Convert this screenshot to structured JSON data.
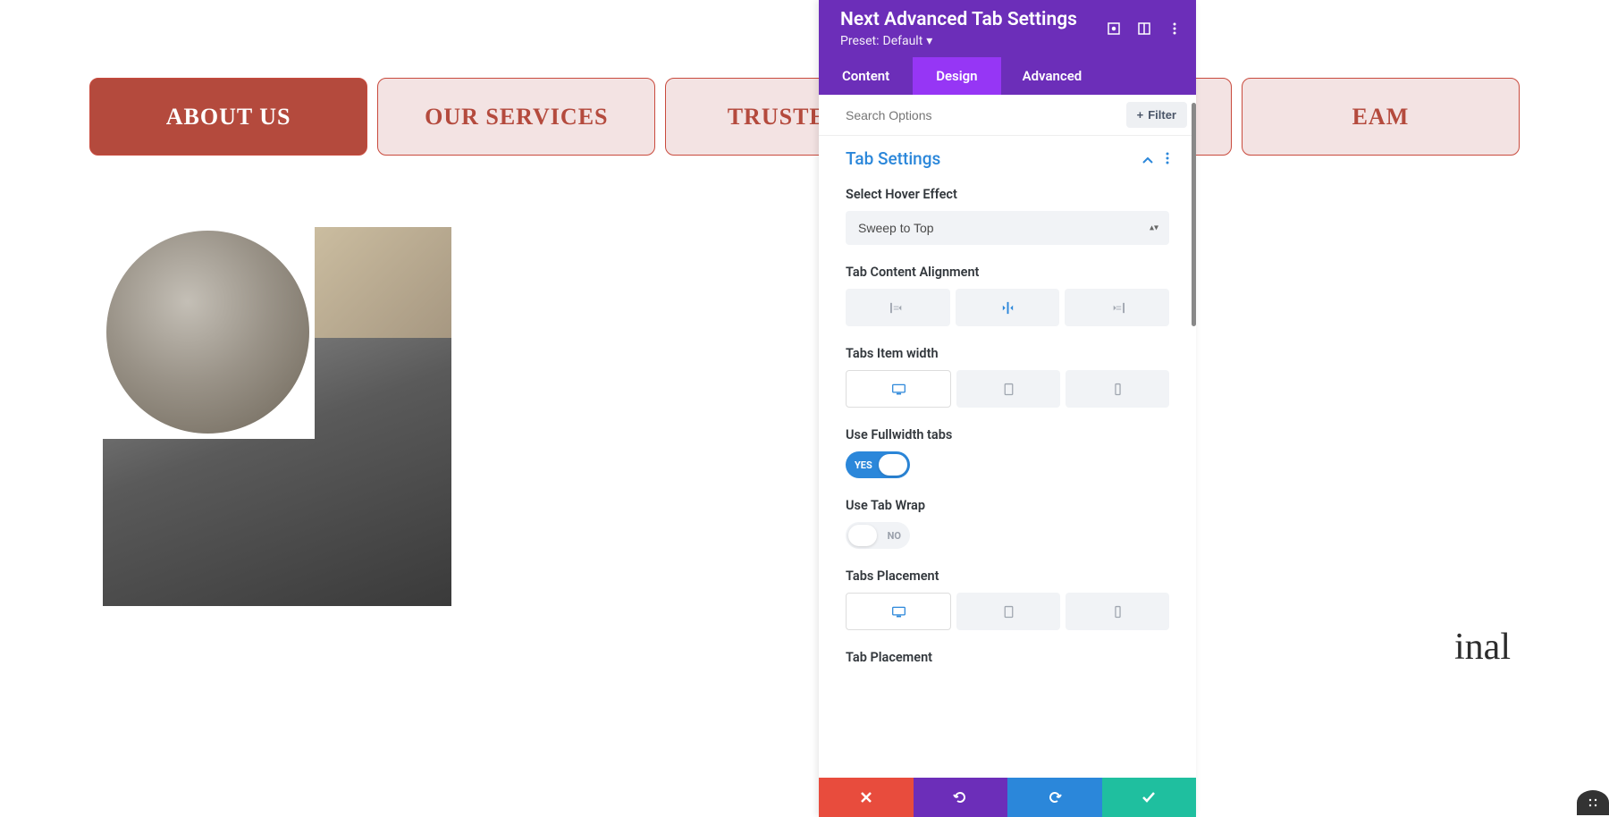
{
  "page": {
    "tabs": [
      {
        "label": "ABOUT US"
      },
      {
        "label": "OUR SERVICES"
      },
      {
        "label": "TRUSTED US"
      },
      {
        "label": ""
      },
      {
        "label_partial": "EAM"
      }
    ],
    "partial_heading": "inal"
  },
  "panel": {
    "title": "Next Advanced Tab Settings",
    "preset_label": "Preset:",
    "preset_value": "Default",
    "tabs": {
      "content": "Content",
      "design": "Design",
      "advanced": "Advanced"
    },
    "search_placeholder": "Search Options",
    "filter_label": "Filter",
    "section_title": "Tab Settings",
    "fields": {
      "hover_effect": {
        "label": "Select Hover Effect",
        "value": "Sweep to Top"
      },
      "content_alignment": {
        "label": "Tab Content Alignment"
      },
      "item_width": {
        "label": "Tabs Item width"
      },
      "fullwidth": {
        "label": "Use Fullwidth tabs",
        "value": "YES"
      },
      "tab_wrap": {
        "label": "Use Tab Wrap",
        "value": "NO"
      },
      "tabs_placement": {
        "label": "Tabs Placement"
      },
      "tab_placement": {
        "label": "Tab Placement"
      }
    }
  }
}
